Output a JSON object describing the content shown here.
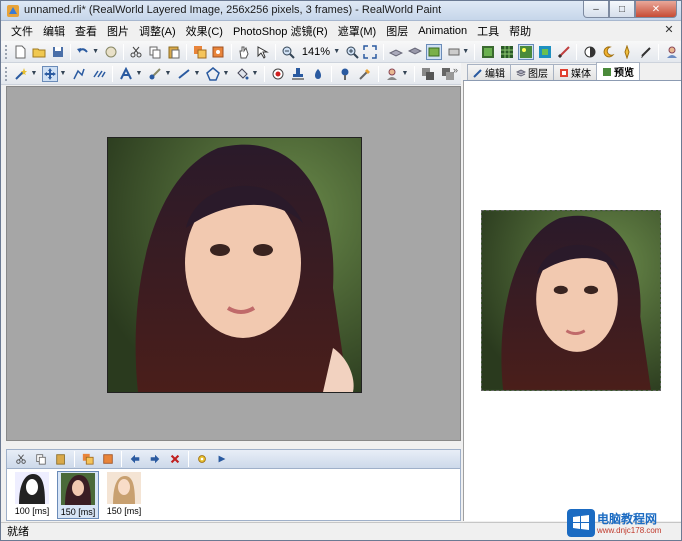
{
  "window": {
    "title": "unnamed.rli* (RealWorld Layered Image, 256x256 pixels, 3 frames) - RealWorld Paint",
    "minimize_glyph": "–",
    "maximize_glyph": "□",
    "close_glyph": "✕"
  },
  "menu": {
    "items": [
      "文件",
      "编辑",
      "查看",
      "图片",
      "调整(A)",
      "效果(C)",
      "PhotoShop 滤镜(R)",
      "遮罩(M)",
      "图层",
      "Animation",
      "工具",
      "帮助"
    ],
    "close_glyph": "✕"
  },
  "toolbar": {
    "zoom": "141%"
  },
  "panel": {
    "tabs": [
      "编辑",
      "图层",
      "媒体",
      "预览"
    ],
    "active_tab": "预览",
    "collapse_glyph": "»"
  },
  "frames": [
    {
      "label": "100 [ms]",
      "selected": false
    },
    {
      "label": "150 [ms]",
      "selected": true
    },
    {
      "label": "150 [ms]",
      "selected": false
    }
  ],
  "status": {
    "text": "就绪"
  },
  "watermark": {
    "title": "电脑教程网",
    "url": "www.dnjc178.com"
  },
  "colors": {
    "canvas_bg": "#a6a6a6",
    "accent": "#1b6bc2"
  }
}
